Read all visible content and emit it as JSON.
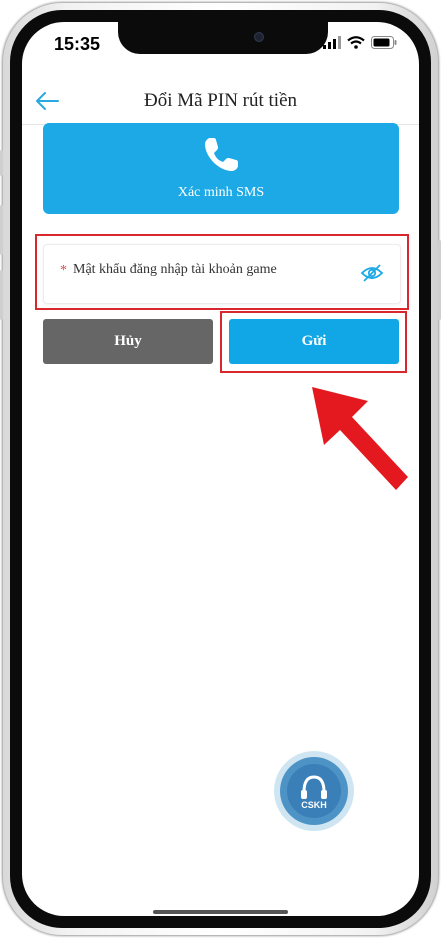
{
  "status_bar": {
    "time": "15:35"
  },
  "header": {
    "title": "Đổi Mã PIN rút tiền",
    "back_icon": "arrow-left-icon"
  },
  "sms_card": {
    "label": "Xác minh SMS",
    "icon": "phone-icon"
  },
  "password_field": {
    "required_mark": "*",
    "placeholder": "Mật khẩu đăng nhập tài khoản game",
    "toggle_icon": "eye-icon"
  },
  "buttons": {
    "cancel": "Hủy",
    "send": "Gửi"
  },
  "support": {
    "label": "CSKH"
  },
  "colors": {
    "accent": "#1da9e6",
    "cancel_bg": "#666666",
    "highlight": "#d9272e"
  }
}
